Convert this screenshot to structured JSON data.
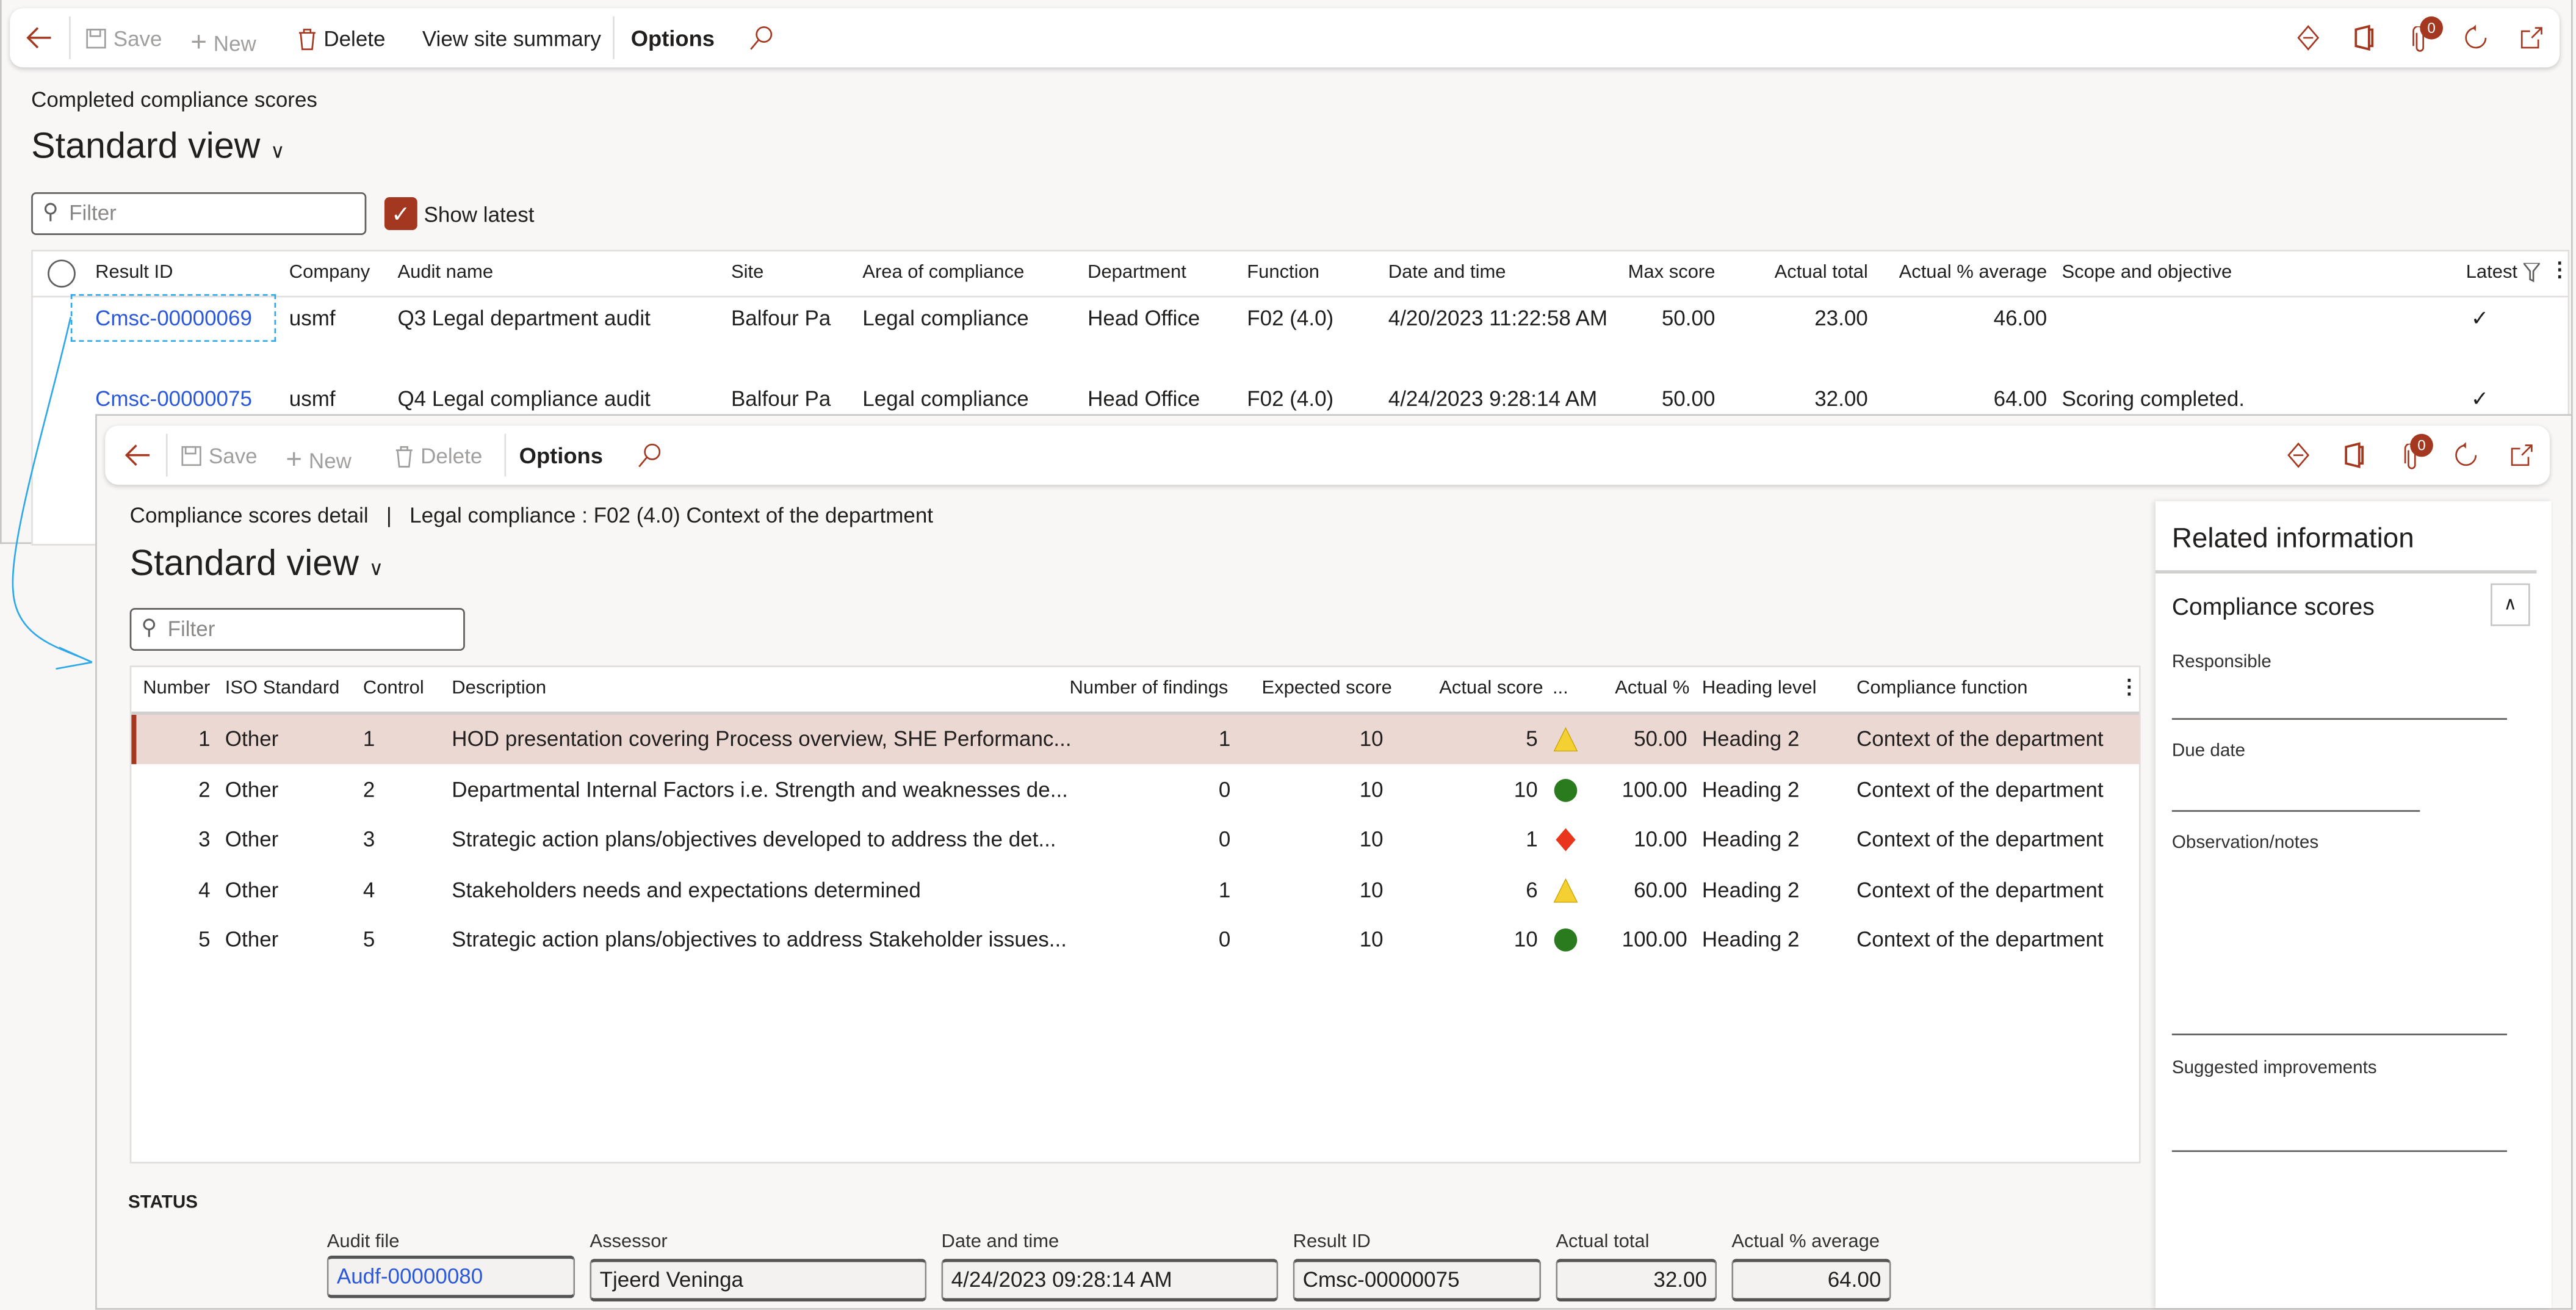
{
  "back": {
    "toolbar": {
      "save": "Save",
      "new": "New",
      "delete": "Delete",
      "view_site_summary": "View site summary",
      "options": "Options",
      "notification_count": "0"
    },
    "page_caption": "Completed compliance scores",
    "view_title": "Standard view",
    "filter_placeholder": "Filter",
    "show_latest_label": "Show latest",
    "show_latest_checked": true,
    "columns": [
      "Result ID",
      "Company",
      "Audit name",
      "Site",
      "Area of compliance",
      "Department",
      "Function",
      "Date and time",
      "Max score",
      "Actual total",
      "Actual % average",
      "Scope and objective",
      "Latest"
    ],
    "rows": [
      {
        "result_id": "Cmsc-00000069",
        "company": "usmf",
        "audit_name": "Q3 Legal department audit",
        "site": "Balfour Pa",
        "area": "Legal compliance",
        "department": "Head Office",
        "function": "F02 (4.0)",
        "date": "4/20/2023 11:22:58 AM",
        "max": "50.00",
        "total": "23.00",
        "avg": "46.00",
        "scope": "",
        "latest": true
      },
      {
        "result_id": "Cmsc-00000075",
        "company": "usmf",
        "audit_name": "Q4 Legal compliance audit",
        "site": "Balfour Pa",
        "area": "Legal compliance",
        "department": "Head Office",
        "function": "F02 (4.0)",
        "date": "4/24/2023 9:28:14 AM",
        "max": "50.00",
        "total": "32.00",
        "avg": "64.00",
        "scope": "Scoring completed.",
        "latest": true
      }
    ]
  },
  "front": {
    "toolbar": {
      "save": "Save",
      "new": "New",
      "delete": "Delete",
      "options": "Options",
      "notification_count": "0"
    },
    "breadcrumb": "Compliance scores detail",
    "breadcrumb_sep": "|",
    "breadcrumb_context": "Legal compliance : F02 (4.0) Context of the department",
    "view_title": "Standard view",
    "filter_placeholder": "Filter",
    "columns": [
      "Number",
      "ISO Standard",
      "Control",
      "Description",
      "Number of findings",
      "Expected score",
      "Actual score",
      "...",
      "Actual %",
      "Heading level",
      "Compliance function"
    ],
    "rows": [
      {
        "number": "1",
        "iso": "Other",
        "control": "1",
        "description": "HOD presentation covering Process overview, SHE Performanc...",
        "findings": "1",
        "expected": "10",
        "actual": "5",
        "indicator": "yellow-triangle",
        "pct": "50.00",
        "heading": "Heading 2",
        "function": "Context of the department"
      },
      {
        "number": "2",
        "iso": "Other",
        "control": "2",
        "description": "Departmental Internal Factors i.e. Strength and weaknesses de...",
        "findings": "0",
        "expected": "10",
        "actual": "10",
        "indicator": "green-circle",
        "pct": "100.00",
        "heading": "Heading 2",
        "function": "Context of the department"
      },
      {
        "number": "3",
        "iso": "Other",
        "control": "3",
        "description": "Strategic action plans/objectives developed to address the det...",
        "findings": "0",
        "expected": "10",
        "actual": "1",
        "indicator": "red-diamond",
        "pct": "10.00",
        "heading": "Heading 2",
        "function": "Context of the department"
      },
      {
        "number": "4",
        "iso": "Other",
        "control": "4",
        "description": "Stakeholders needs and expectations determined",
        "findings": "1",
        "expected": "10",
        "actual": "6",
        "indicator": "yellow-triangle",
        "pct": "60.00",
        "heading": "Heading 2",
        "function": "Context of the department"
      },
      {
        "number": "5",
        "iso": "Other",
        "control": "5",
        "description": "Strategic action plans/objectives to address Stakeholder issues...",
        "findings": "0",
        "expected": "10",
        "actual": "10",
        "indicator": "green-circle",
        "pct": "100.00",
        "heading": "Heading 2",
        "function": "Context of the department"
      }
    ],
    "status": {
      "heading": "STATUS",
      "audit_file_label": "Audit file",
      "audit_file": "Audf-00000080",
      "assessor_label": "Assessor",
      "assessor": "Tjeerd Veninga",
      "date_label": "Date and time",
      "date": "4/24/2023 09:28:14 AM",
      "result_id_label": "Result ID",
      "result_id": "Cmsc-00000075",
      "actual_total_label": "Actual total",
      "actual_total": "32.00",
      "actual_avg_label": "Actual % average",
      "actual_avg": "64.00"
    },
    "related": {
      "title": "Related information",
      "section": "Compliance scores",
      "responsible_label": "Responsible",
      "due_date_label": "Due date",
      "observation_label": "Observation/notes",
      "suggested_label": "Suggested improvements"
    }
  },
  "colors": {
    "accent": "#a4371f",
    "link": "#2b58d8",
    "selected_row": "#ecd8d2",
    "green": "#2a7a1e",
    "yellow": "#f5d033",
    "red": "#e8351b"
  }
}
